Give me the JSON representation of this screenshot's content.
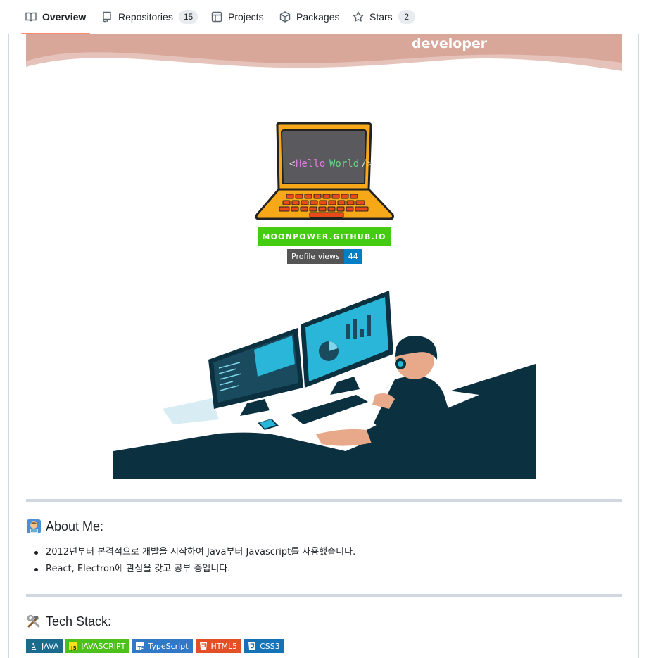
{
  "tabs": [
    {
      "label": "Overview",
      "icon": "book-icon",
      "active": true
    },
    {
      "label": "Repositories",
      "icon": "repo-icon",
      "count": "15"
    },
    {
      "label": "Projects",
      "icon": "table-icon"
    },
    {
      "label": "Packages",
      "icon": "package-icon"
    },
    {
      "label": "Stars",
      "icon": "star-icon",
      "count": "2"
    }
  ],
  "readme": {
    "banner_title": "developer",
    "laptop_text": {
      "open": "<",
      "hello": "Hello",
      "world": "World",
      "close": "/>"
    },
    "site_badge": "MOONPOWER.GITHUB.IO",
    "views_badge": {
      "label": "Profile views",
      "value": "44"
    },
    "about": {
      "heading": "About Me:",
      "items": [
        "2012년부터 본격적으로 개발을 시작하여 Java부터 Javascript를 사용했습니다.",
        "React, Electron에 관심을 갖고 공부 중입니다."
      ]
    },
    "tech": {
      "heading": "Tech Stack:",
      "badges": [
        {
          "label": "JAVA",
          "color": "#1a6b8e",
          "icon": "java-icon"
        },
        {
          "label": "JAVASCRIPT",
          "color": "#4dc01c",
          "icon": "js-icon"
        },
        {
          "label": "TypeScript",
          "color": "#3178c6",
          "icon": "ts-icon"
        },
        {
          "label": "HTML5",
          "color": "#e34f26",
          "icon": "html5-icon"
        },
        {
          "label": "CSS3",
          "color": "#1572b6",
          "icon": "css3-icon"
        }
      ]
    }
  },
  "colors": {
    "banner": "#d8a79a",
    "tab_underline": "#fd8c73",
    "illustration_dark": "#0b3040",
    "screen_accent": "#29b6d8"
  }
}
